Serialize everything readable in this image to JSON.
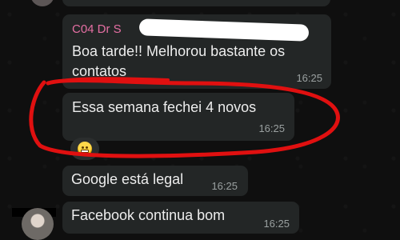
{
  "messages": [
    {
      "sender": "C04 Dr S",
      "text": "Boa tarde!! Melhorou bastante os\ncontatos",
      "time": "16:25"
    },
    {
      "text": "Essa semana fechei 4 novos",
      "time": "16:25",
      "reaction": "grimacing-face-emoji"
    },
    {
      "text": "Google está legal",
      "time": "16:25"
    },
    {
      "text": "Facebook continua bom",
      "time": "16:25"
    }
  ],
  "colors": {
    "background": "#0f0f0f",
    "bubble": "#232626",
    "sender_name": "#e56fa3",
    "annotation": "#e01010",
    "timestamp": "#9aa0a0"
  }
}
